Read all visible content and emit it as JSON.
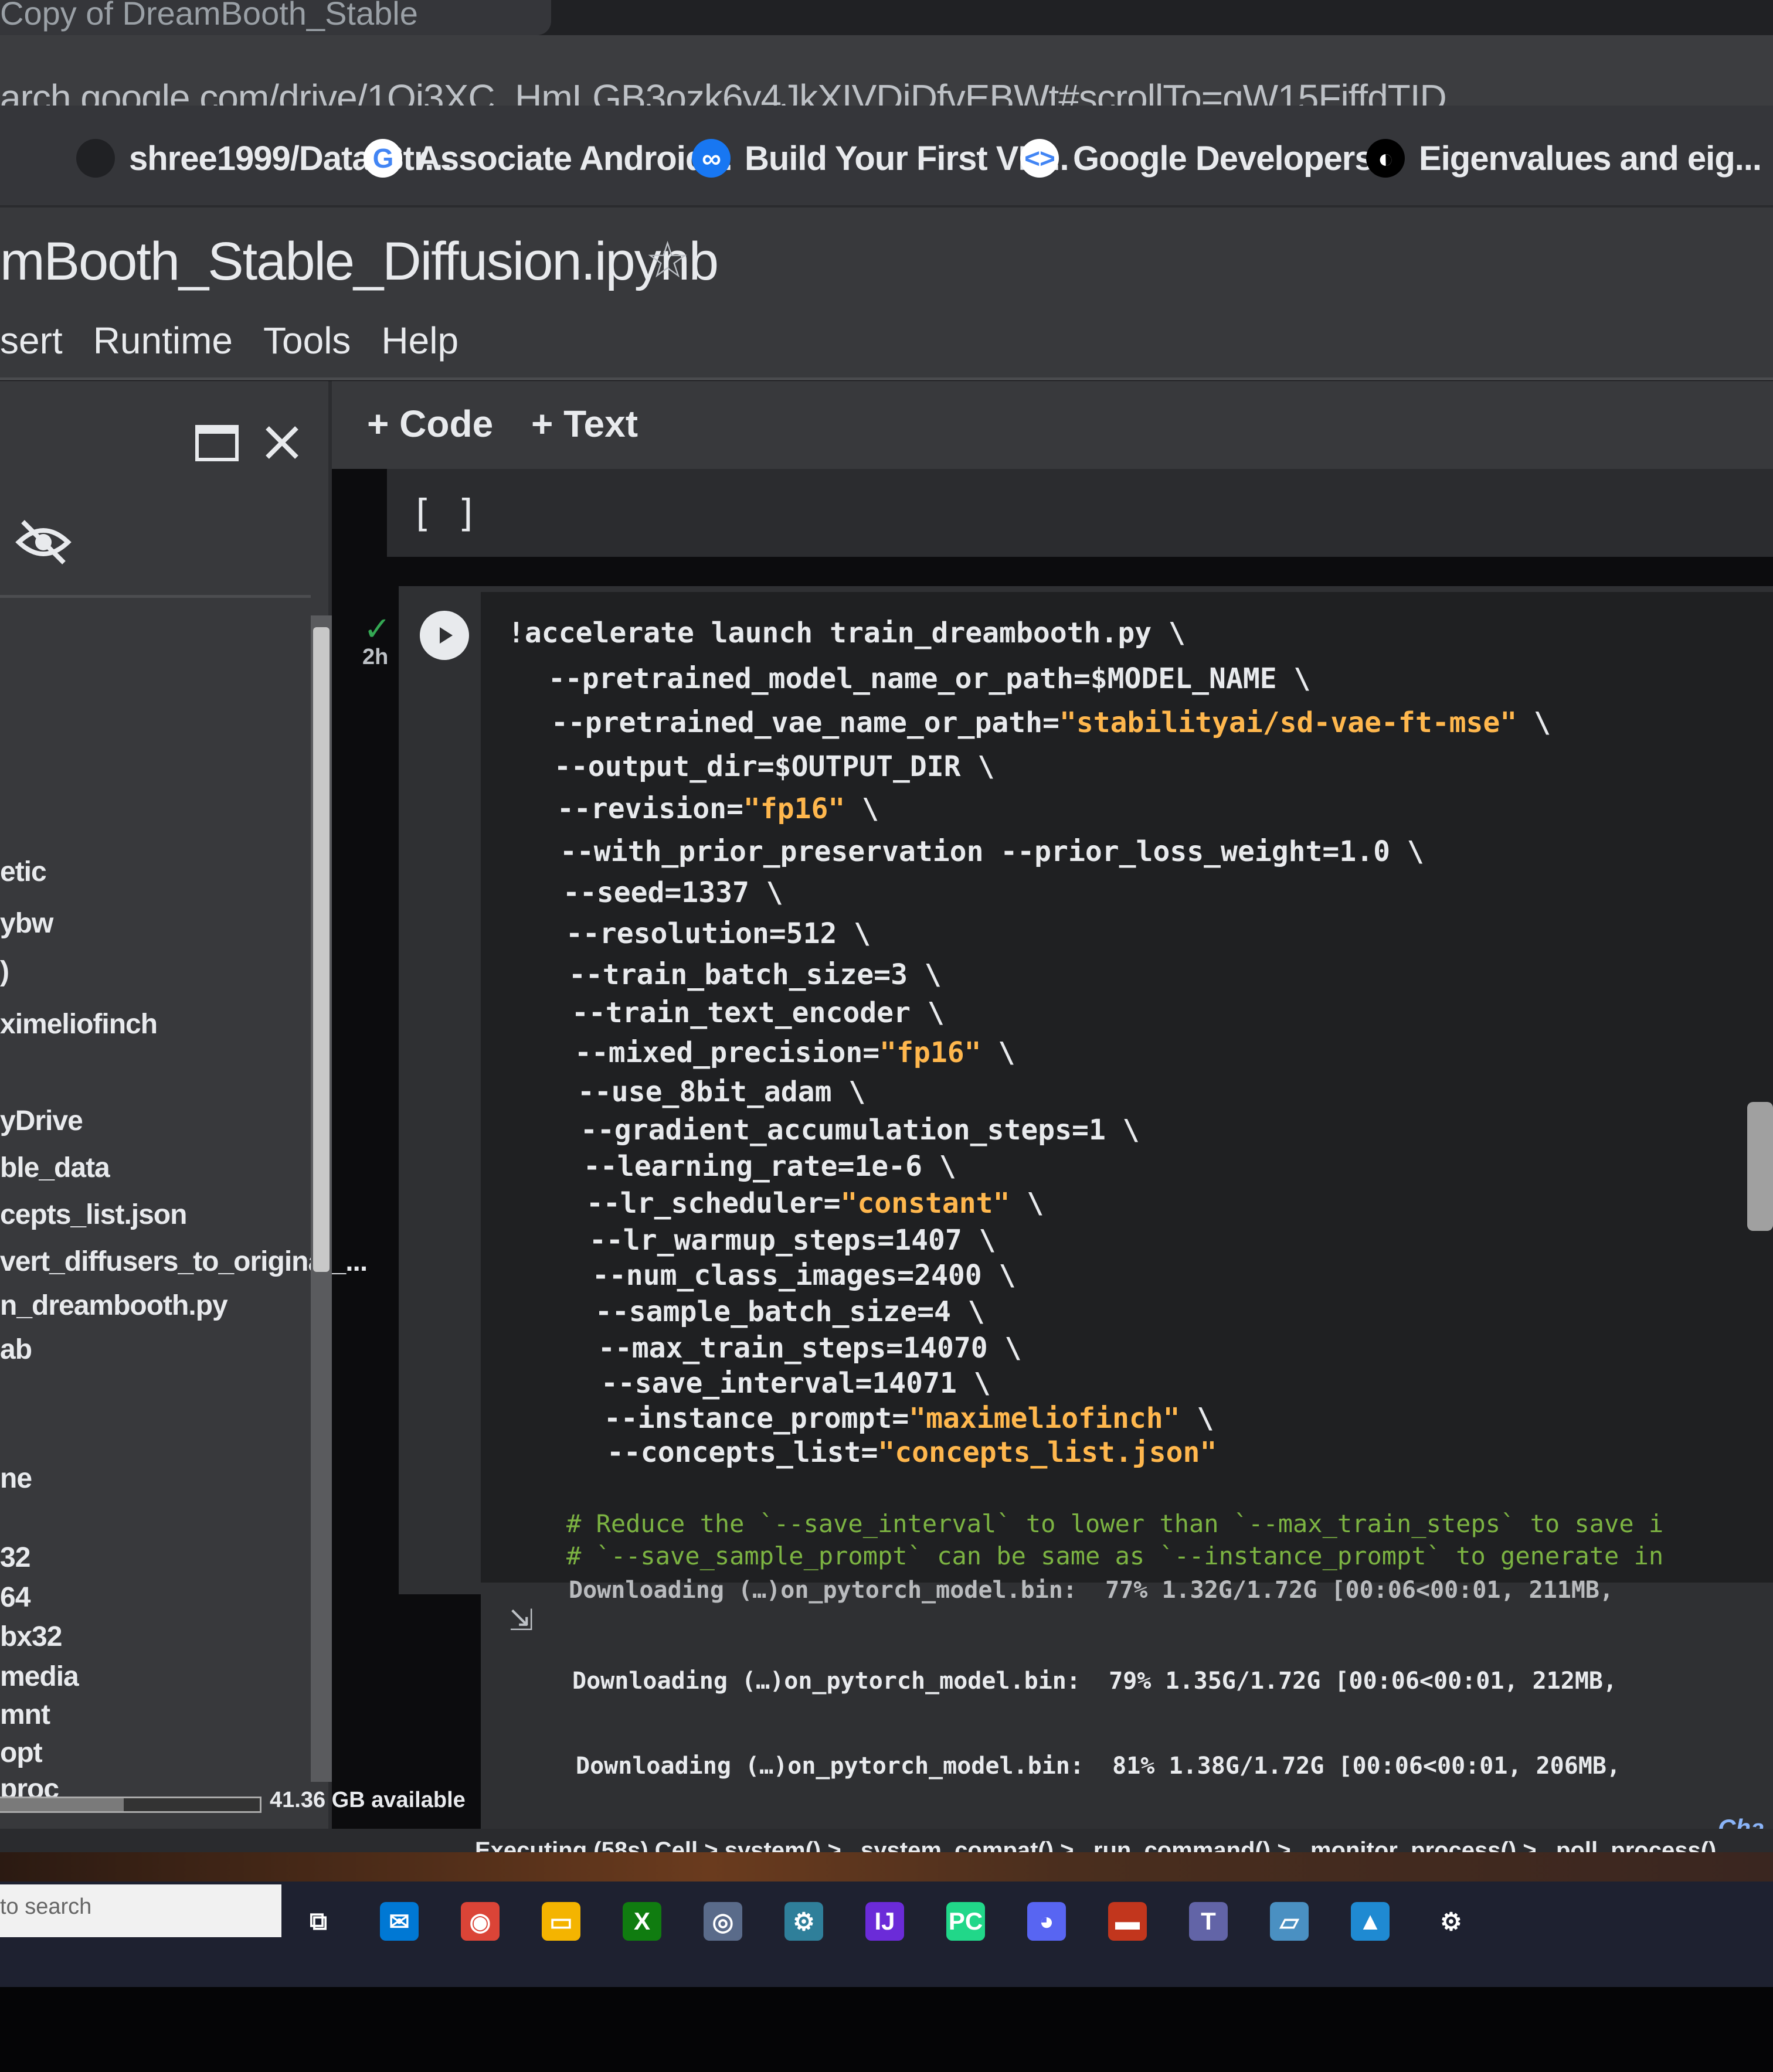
{
  "browser": {
    "tab_title": "Copy of DreamBooth_Stable",
    "url": "arch.google.com/drive/1Qi3XC_HmLGB3ozk6y4JkXIVDjDfvEBWt#scrollTo=gW15FjffdTID",
    "bookmarks": [
      {
        "label": "shree1999/Data-Str...",
        "icon": "github-icon",
        "color": "#202124"
      },
      {
        "label": "Associate Android...",
        "icon": "google-icon",
        "color": "#ffffff"
      },
      {
        "label": "Build Your First VR...",
        "icon": "meta-icon",
        "color": "#1877f2"
      },
      {
        "label": "Google Developers...",
        "icon": "google-developers-icon",
        "color": "#ffffff"
      },
      {
        "label": "Eigenvalues and eig...",
        "icon": "3b1b-icon",
        "color": "#000000"
      }
    ]
  },
  "notebook": {
    "title": "mBooth_Stable_Diffusion.ipynb",
    "menu": [
      "sert",
      "Runtime",
      "Tools",
      "Help"
    ]
  },
  "toolbar": {
    "add_code": "+ Code",
    "add_text": "+ Text"
  },
  "files": {
    "items": [
      "etic",
      "ybw",
      ")",
      "ximeliofinch",
      "yDrive",
      "ble_data",
      "cepts_list.json",
      "vert_diffusers_to_original_...",
      "n_dreambooth.py",
      "ab",
      "ne",
      "32",
      "64",
      "bx32",
      "media",
      "mnt",
      "opt",
      "proc"
    ],
    "disk_used_fraction": 0.48,
    "disk_text": "41.36 GB available"
  },
  "empty_cell": {
    "brackets": "[ ]"
  },
  "cell": {
    "status_check": "✓",
    "exec_time": "2h",
    "lines": [
      {
        "plain": "!accelerate launch train_dreambooth.py \\",
        "str": "",
        "tail": ""
      },
      {
        "plain": "--pretrained_model_name_or_path=$MODEL_NAME \\",
        "str": "",
        "tail": ""
      },
      {
        "plain": "--pretrained_vae_name_or_path=",
        "str": "\"stabilityai/sd-vae-ft-mse\"",
        "tail": " \\"
      },
      {
        "plain": "--output_dir=$OUTPUT_DIR \\",
        "str": "",
        "tail": ""
      },
      {
        "plain": "--revision=",
        "str": "\"fp16\"",
        "tail": " \\"
      },
      {
        "plain": "--with_prior_preservation --prior_loss_weight=1.0 \\",
        "str": "",
        "tail": ""
      },
      {
        "plain": "--seed=1337 \\",
        "str": "",
        "tail": ""
      },
      {
        "plain": "--resolution=512 \\",
        "str": "",
        "tail": ""
      },
      {
        "plain": "--train_batch_size=3 \\",
        "str": "",
        "tail": ""
      },
      {
        "plain": "--train_text_encoder \\",
        "str": "",
        "tail": ""
      },
      {
        "plain": "--mixed_precision=",
        "str": "\"fp16\"",
        "tail": " \\"
      },
      {
        "plain": "--use_8bit_adam \\",
        "str": "",
        "tail": ""
      },
      {
        "plain": "--gradient_accumulation_steps=1 \\",
        "str": "",
        "tail": ""
      },
      {
        "plain": "--learning_rate=1e-6 \\",
        "str": "",
        "tail": ""
      },
      {
        "plain": "--lr_scheduler=",
        "str": "\"constant\"",
        "tail": " \\"
      },
      {
        "plain": "--lr_warmup_steps=1407 \\",
        "str": "",
        "tail": ""
      },
      {
        "plain": "--num_class_images=2400 \\",
        "str": "",
        "tail": ""
      },
      {
        "plain": "--sample_batch_size=4 \\",
        "str": "",
        "tail": ""
      },
      {
        "plain": "--max_train_steps=14070 \\",
        "str": "",
        "tail": ""
      },
      {
        "plain": "--save_interval=14071 \\",
        "str": "",
        "tail": ""
      },
      {
        "plain": "--instance_prompt=",
        "str": "\"maximeliofinch\"",
        "tail": " \\"
      },
      {
        "plain": "--concepts_list=",
        "str": "\"concepts_list.json\"",
        "tail": ""
      }
    ],
    "comments": [
      "# Reduce the `--save_interval` to lower than `--max_train_steps` to save i",
      "# `--save_sample_prompt` can be same as `--instance_prompt` to generate in"
    ]
  },
  "output": {
    "lines": [
      "Downloading (…)on_pytorch_model.bin:  77% 1.32G/1.72G [00:06<00:01, 211MB,",
      "Downloading (…)on_pytorch_model.bin:  79% 1.35G/1.72G [00:06<00:01, 212MB,",
      "Downloading (…)on_pytorch_model.bin:  81% 1.38G/1.72G [00:06<00:01, 206MB,"
    ]
  },
  "chat_link": "Cha",
  "status": {
    "text": "Executing (58s)  Cell > system() > _system_compat() > _run_command() > _monitor_process() > _poll_process()"
  },
  "taskbar": {
    "search_placeholder": "to search",
    "apps": [
      {
        "name": "task-view-icon",
        "glyph": "⧉",
        "color": "#1e2130"
      },
      {
        "name": "mail-icon",
        "glyph": "✉",
        "color": "#0078d4"
      },
      {
        "name": "chrome-icon",
        "glyph": "◉",
        "color": "#db4437"
      },
      {
        "name": "file-explorer-icon",
        "glyph": "▭",
        "color": "#f4b400"
      },
      {
        "name": "xbox-icon",
        "glyph": "X",
        "color": "#107c10"
      },
      {
        "name": "app-circle-icon",
        "glyph": "◎",
        "color": "#5a6b8a"
      },
      {
        "name": "control-icon",
        "glyph": "⚙",
        "color": "#2f7f9a"
      },
      {
        "name": "intellij-icon",
        "glyph": "IJ",
        "color": "#6b2bd8"
      },
      {
        "name": "pycharm-icon",
        "glyph": "PC",
        "color": "#21d789"
      },
      {
        "name": "discord-icon",
        "glyph": "◕",
        "color": "#5865f2"
      },
      {
        "name": "app-red-icon",
        "glyph": "▬",
        "color": "#c2361d"
      },
      {
        "name": "teams-icon",
        "glyph": "T",
        "color": "#6264a7"
      },
      {
        "name": "terminal-icon",
        "glyph": "▱",
        "color": "#4a90c2"
      },
      {
        "name": "photos-icon",
        "glyph": "▲",
        "color": "#1f8ad2"
      },
      {
        "name": "settings-icon",
        "glyph": "⚙",
        "color": "#1e2130"
      }
    ]
  }
}
